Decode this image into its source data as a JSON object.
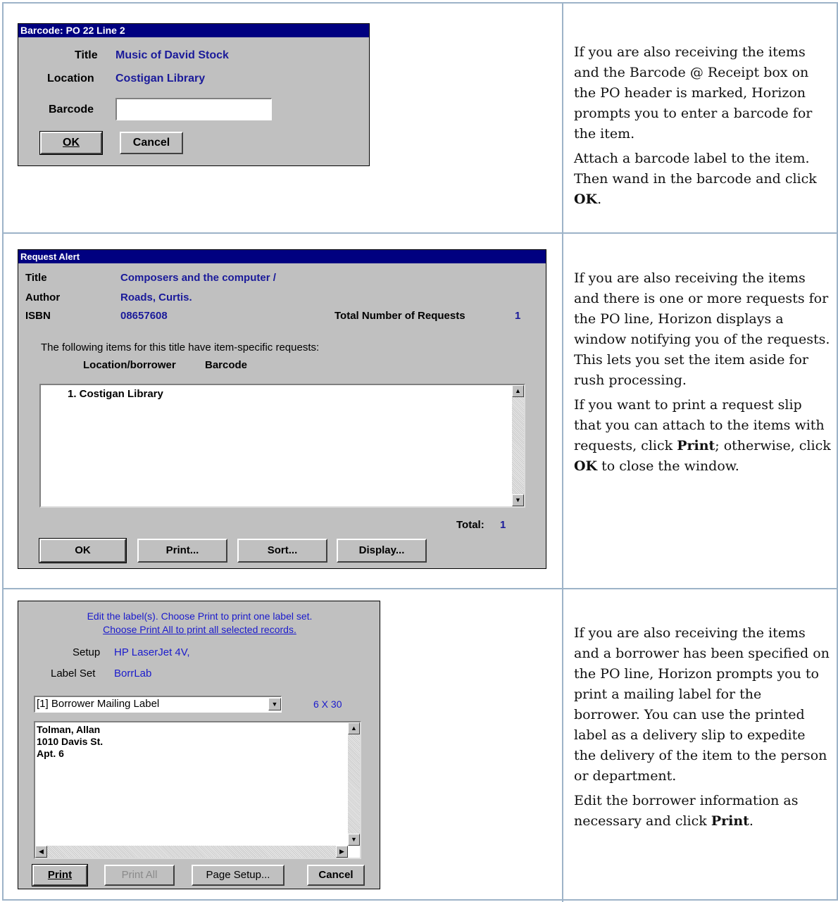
{
  "barcode_dialog": {
    "title": "Barcode: PO 22 Line 2",
    "title_label": "Title",
    "title_value": "Music of David Stock",
    "location_label": "Location",
    "location_value": "Costigan Library",
    "barcode_label": "Barcode",
    "barcode_value": "",
    "ok_label": "OK",
    "cancel_label": "Cancel"
  },
  "request_alert": {
    "title": "Request Alert",
    "title_label": "Title",
    "title_value": "Composers and the computer /",
    "author_label": "Author",
    "author_value": "Roads, Curtis.",
    "isbn_label": "ISBN",
    "isbn_value": "08657608",
    "total_requests_label": "Total Number of Requests",
    "total_requests_value": "1",
    "items_heading": "The following items for this title have item-specific requests:",
    "col_location": "Location/borrower",
    "col_barcode": "Barcode",
    "list_items": [
      "1. Costigan Library"
    ],
    "total_label": "Total:",
    "total_value": "1",
    "buttons": [
      "OK",
      "Print...",
      "Sort...",
      "Display..."
    ]
  },
  "label_dialog": {
    "instruction_line1": "Edit the label(s). Choose Print to print one label set.",
    "instruction_line2": "Choose Print All to print all selected records.",
    "setup_label": "Setup",
    "setup_value": "HP LaserJet 4V,",
    "labelset_label": "Label Set",
    "labelset_value": "BorrLab",
    "dropdown_value": "[1] Borrower Mailing Label",
    "size_value": "6 X 30",
    "label_text": [
      "Tolman, Allan",
      "1010 Davis St.",
      "Apt. 6"
    ],
    "print_label": "Print",
    "print_all_label": "Print All",
    "page_setup_label": "Page Setup...",
    "cancel_label": "Cancel"
  },
  "descriptions": {
    "row1_p1_a": "If you are also receiving the items and the Barcode @ Receipt box on the PO header is marked, Horizon prompts you to enter a barcode for the item.",
    "row1_p2_a": "Attach a barcode label to the item. Then wand in the barcode and click ",
    "row1_p2_b": "OK",
    "row1_p2_c": ".",
    "row2_p1": "If you are also receiving the items and there is one or more requests for the PO line, Horizon displays a window notifying you of the requests. This lets you set the item aside for rush processing.",
    "row2_p2_a": "If you want to print a request slip that you can attach to the items with requests, click ",
    "row2_p2_b": "Print",
    "row2_p2_c": "; otherwise, click ",
    "row2_p2_d": "OK",
    "row2_p2_e": " to close the window.",
    "row3_p1": "If you are also receiving the items and a borrower has been specified on the PO line, Horizon prompts you to print a mailing label for the borrower. You can use the printed label as a delivery slip to expedite the delivery of the item to the person or department.",
    "row3_p2_a": "Edit the borrower information as necessary and click ",
    "row3_p2_b": "Print",
    "row3_p2_c": "."
  },
  "colors": {
    "title_bar": "#000080",
    "value_text": "#1a1a9a",
    "dialog_bg": "#c0c0c0",
    "table_border": "#9db3c8",
    "link_blue": "#0000ee"
  }
}
